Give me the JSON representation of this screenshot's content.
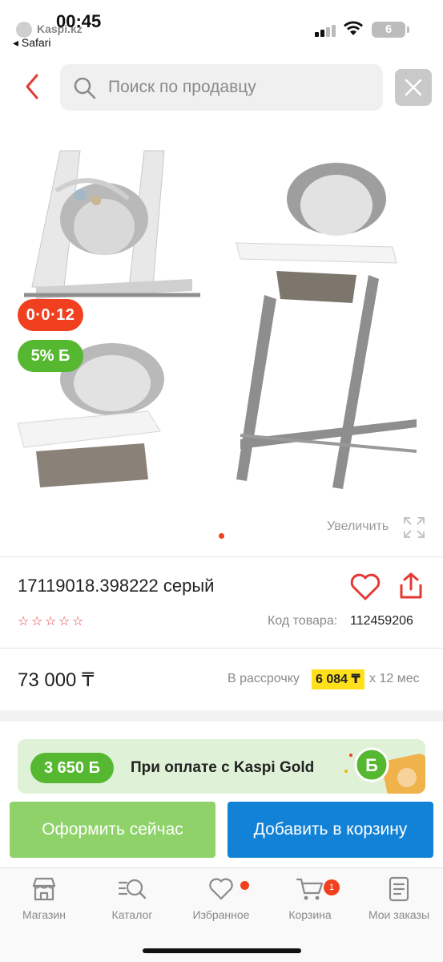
{
  "status_bar": {
    "time": "00:45",
    "app_name": "Kaspi.kz",
    "back_app": "◂ Safari",
    "battery": "6"
  },
  "search": {
    "placeholder": "Поиск по продавцу"
  },
  "gallery": {
    "badge_installment": "0·0·12",
    "badge_bonus": "5% Б",
    "zoom_label": "Увеличить",
    "current_image": 1,
    "image_count": 1
  },
  "product": {
    "title": "17119018.398222 серый",
    "rating": 0,
    "rating_max": 5,
    "code_label": "Код товара:",
    "code_value": "112459206"
  },
  "pricing": {
    "price": "73 000 ₸",
    "installment_label": "В рассрочку",
    "installment_value": "6 084 ₸",
    "installment_term": "х 12 мес"
  },
  "kaspi_gold": {
    "bonus": "3 650 Б",
    "text": "При оплате с Kaspi Gold"
  },
  "actions": {
    "buy_now": "Оформить сейчас",
    "add_to_cart": "Добавить в корзину"
  },
  "tabbar": {
    "items": [
      {
        "label": "Магазин",
        "icon": "store-icon"
      },
      {
        "label": "Каталог",
        "icon": "catalog-search-icon"
      },
      {
        "label": "Избранное",
        "icon": "heart-icon",
        "dot": true
      },
      {
        "label": "Корзина",
        "icon": "cart-icon",
        "count": "1"
      },
      {
        "label": "Мои заказы",
        "icon": "orders-icon"
      }
    ]
  },
  "colors": {
    "accent_red": "#f0401f",
    "bonus_green": "#55b830",
    "cart_blue": "#1282d6",
    "buy_green": "#8fd26a",
    "installment_yellow": "#ffe01a"
  }
}
